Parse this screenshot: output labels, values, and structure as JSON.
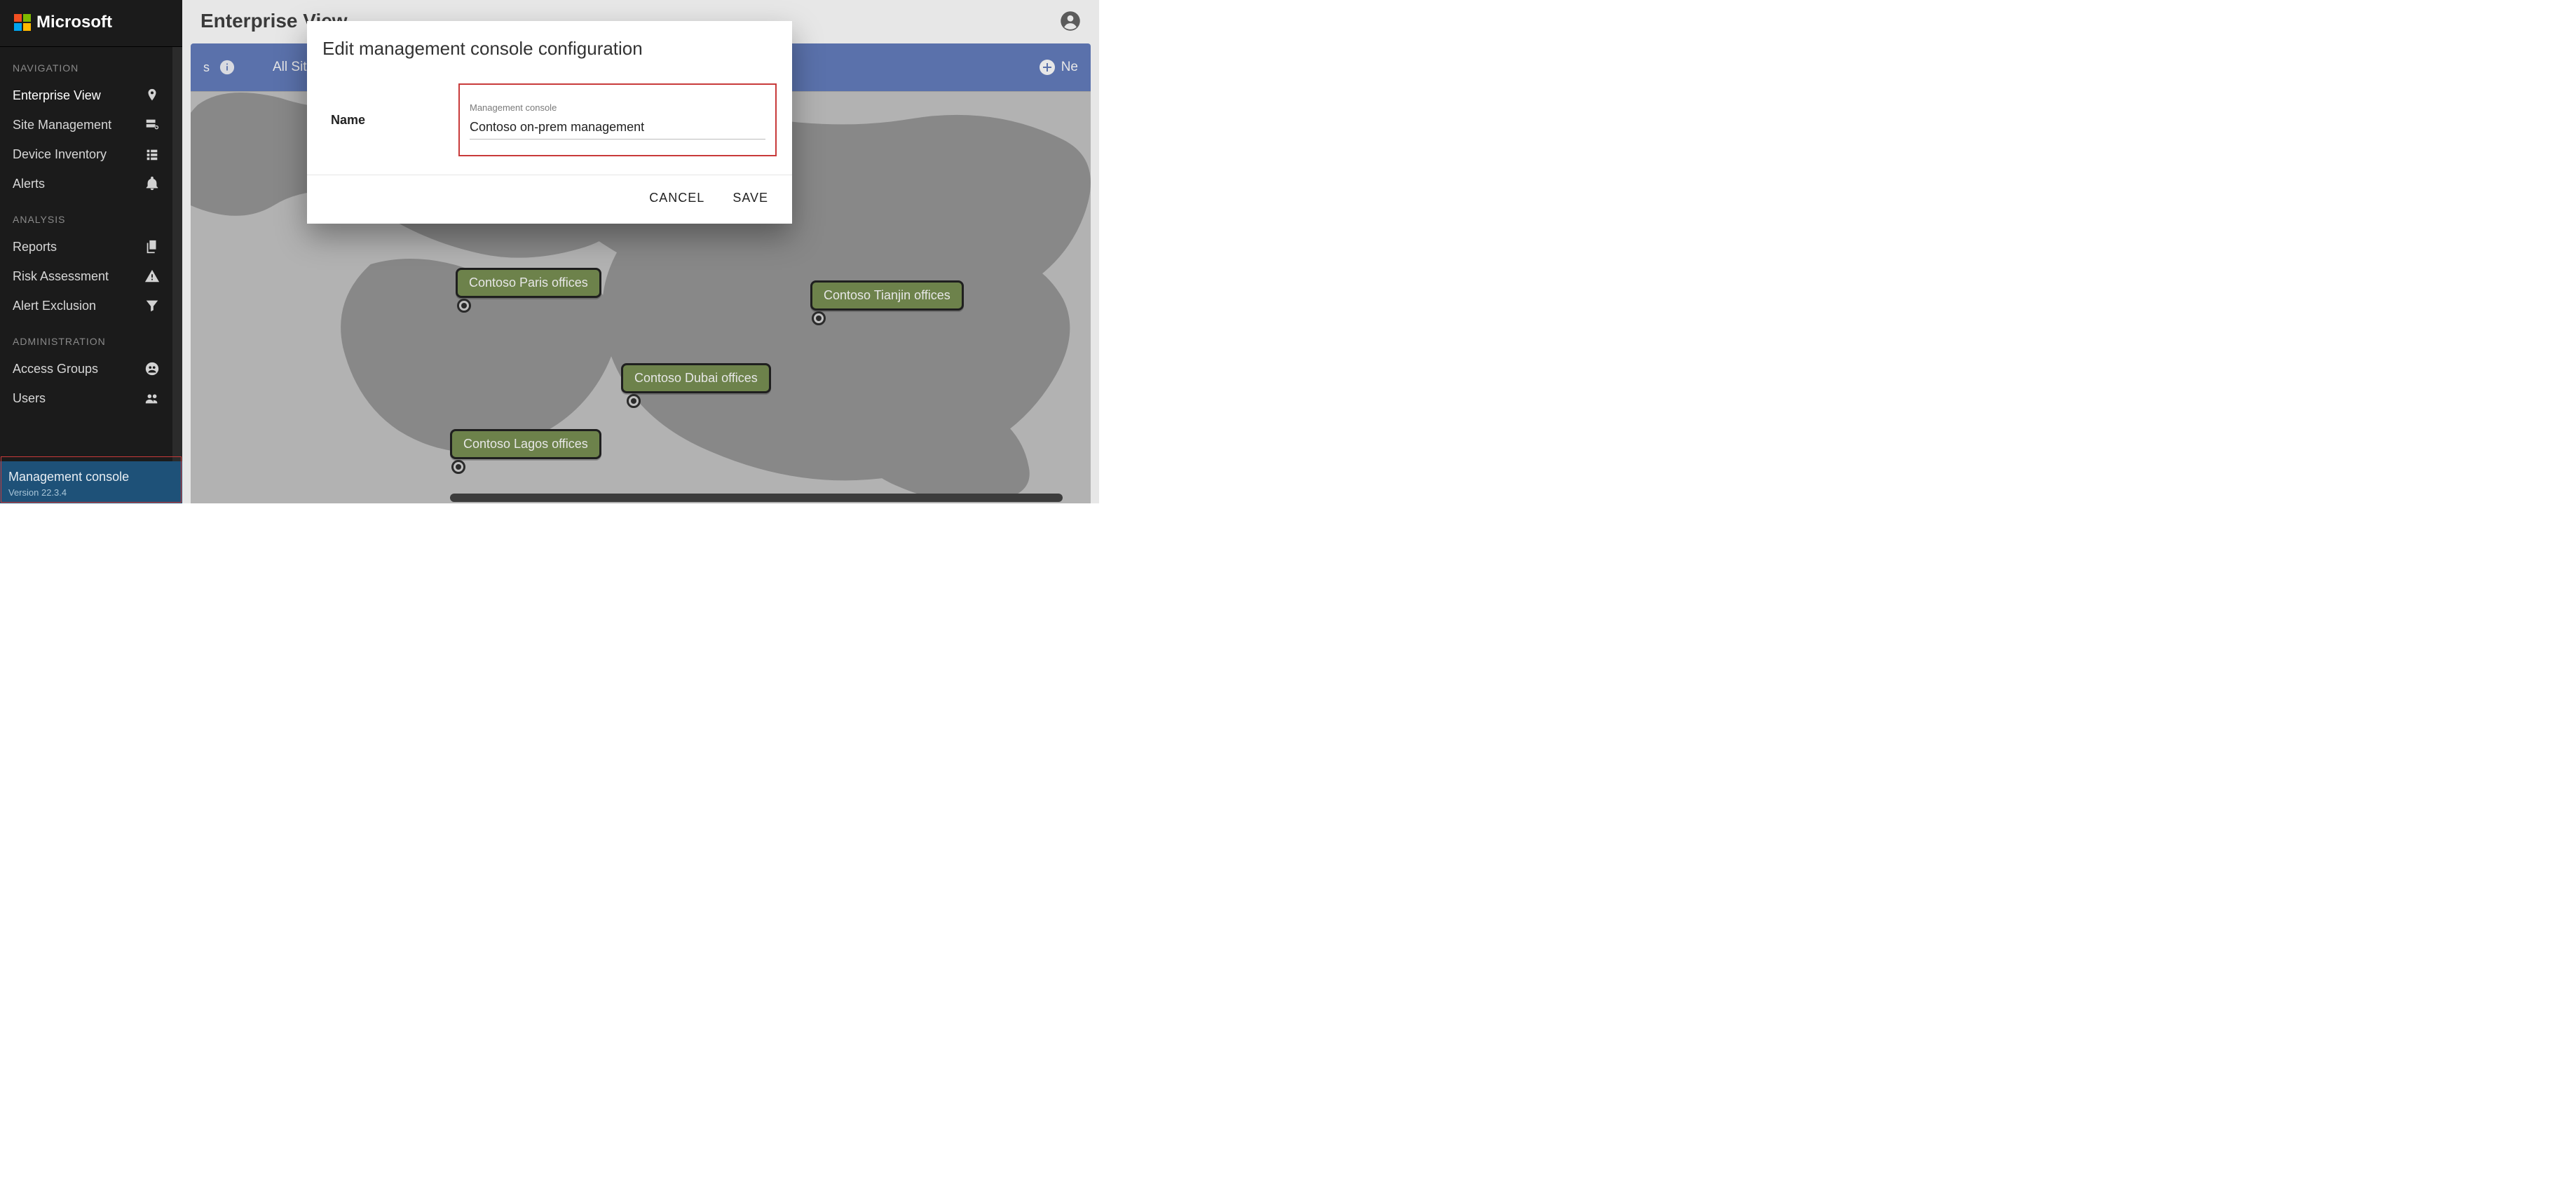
{
  "brand": {
    "name": "Microsoft"
  },
  "sidebar": {
    "sections": {
      "navigation_header": "NAVIGATION",
      "analysis_header": "ANALYSIS",
      "administration_header": "ADMINISTRATION"
    },
    "items": {
      "enterprise_view": "Enterprise View",
      "site_management": "Site Management",
      "device_inventory": "Device Inventory",
      "alerts": "Alerts",
      "reports": "Reports",
      "risk_assessment": "Risk Assessment",
      "alert_exclusion": "Alert Exclusion",
      "access_groups": "Access Groups",
      "users": "Users"
    },
    "footer": {
      "title": "Management console",
      "version": "Version 22.3.4"
    }
  },
  "header": {
    "page_title": "Enterprise View"
  },
  "bluebar": {
    "left_truncated": "s",
    "sites_dropdown_label": "All Sites",
    "new_button_label": "Ne"
  },
  "map": {
    "sites": [
      {
        "name": "Contoso Paris offices"
      },
      {
        "name": "Contoso Tianjin offices"
      },
      {
        "name": "Contoso Dubai offices"
      },
      {
        "name": "Contoso Lagos offices"
      }
    ]
  },
  "dialog": {
    "title": "Edit management console configuration",
    "name_label": "Name",
    "field_float_label": "Management console",
    "field_value": "Contoso on-prem management",
    "cancel": "CANCEL",
    "save": "SAVE"
  }
}
